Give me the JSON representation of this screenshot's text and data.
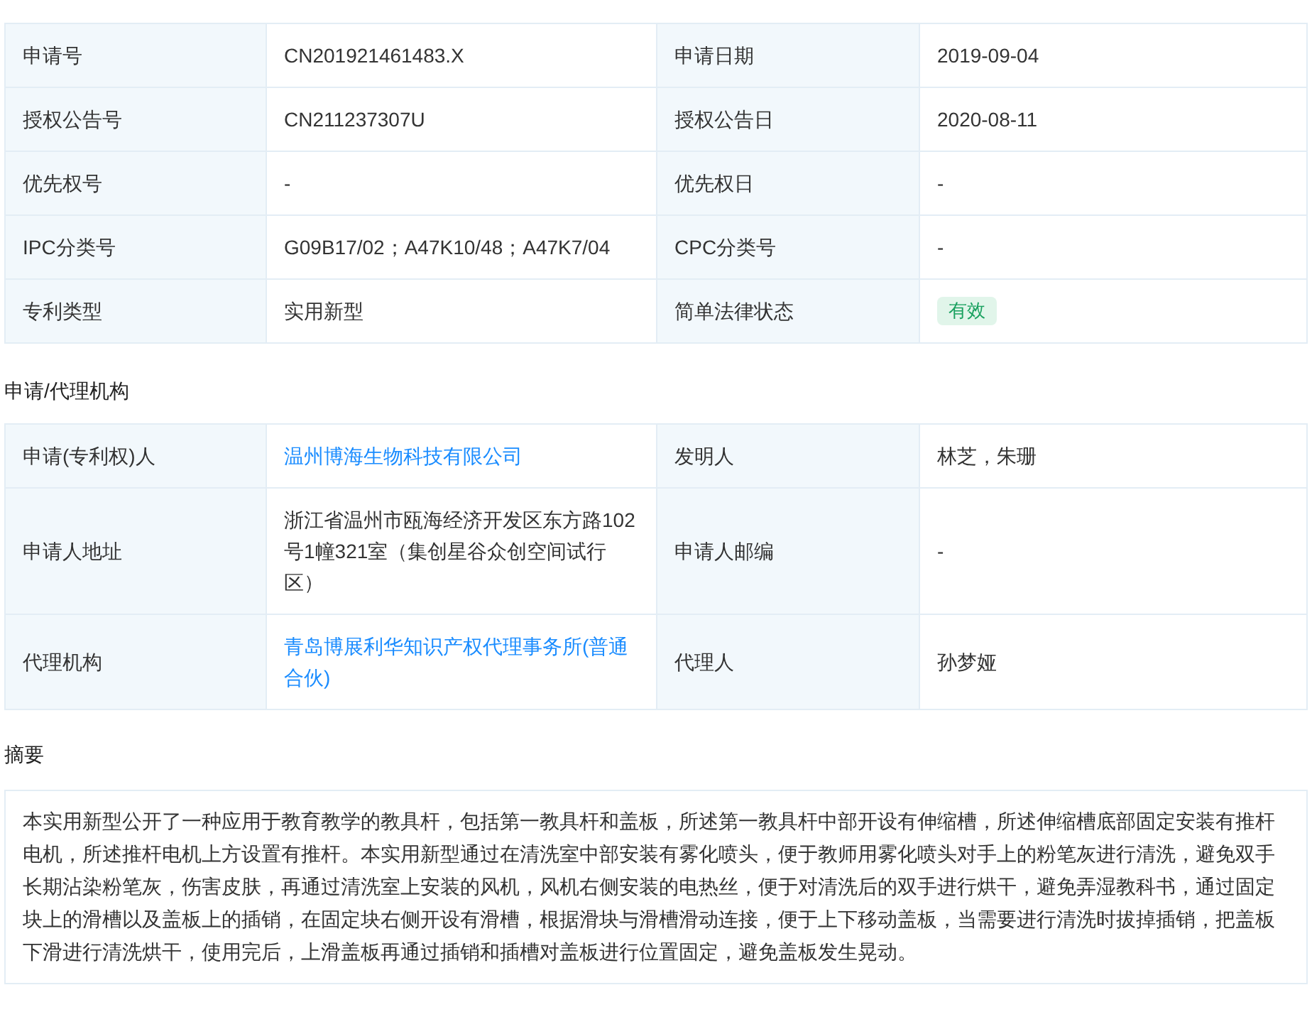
{
  "basic_info": {
    "rows": [
      {
        "cells": [
          {
            "label": "申请号",
            "value": "CN201921461483.X",
            "kind": "text"
          },
          {
            "label": "申请日期",
            "value": "2019-09-04",
            "kind": "text"
          }
        ]
      },
      {
        "cells": [
          {
            "label": "授权公告号",
            "value": "CN211237307U",
            "kind": "text"
          },
          {
            "label": "授权公告日",
            "value": "2020-08-11",
            "kind": "text"
          }
        ]
      },
      {
        "cells": [
          {
            "label": "优先权号",
            "value": "-",
            "kind": "text"
          },
          {
            "label": "优先权日",
            "value": "-",
            "kind": "text"
          }
        ]
      },
      {
        "cells": [
          {
            "label": "IPC分类号",
            "value": "G09B17/02；A47K10/48；A47K7/04",
            "kind": "text"
          },
          {
            "label": "CPC分类号",
            "value": "-",
            "kind": "text"
          }
        ]
      },
      {
        "cells": [
          {
            "label": "专利类型",
            "value": "实用新型",
            "kind": "text"
          },
          {
            "label": "简单法律状态",
            "value": "有效",
            "kind": "badge"
          }
        ]
      }
    ]
  },
  "applicant_agency": {
    "title": "申请/代理机构",
    "rows": [
      {
        "cells": [
          {
            "label": "申请(专利权)人",
            "value": "温州博海生物科技有限公司",
            "kind": "link"
          },
          {
            "label": "发明人",
            "value": "林芝，朱珊",
            "kind": "text"
          }
        ]
      },
      {
        "cells": [
          {
            "label": "申请人地址",
            "value": "浙江省温州市瓯海经济开发区东方路102号1幢321室（集创星谷众创空间试行区）",
            "kind": "text"
          },
          {
            "label": "申请人邮编",
            "value": "-",
            "kind": "text"
          }
        ]
      },
      {
        "cells": [
          {
            "label": "代理机构",
            "value": "青岛博展利华知识产权代理事务所(普通合伙)",
            "kind": "link"
          },
          {
            "label": "代理人",
            "value": "孙梦娅",
            "kind": "text"
          }
        ]
      }
    ]
  },
  "abstract": {
    "title": "摘要",
    "text": "本实用新型公开了一种应用于教育教学的教具杆，包括第一教具杆和盖板，所述第一教具杆中部开设有伸缩槽，所述伸缩槽底部固定安装有推杆电机，所述推杆电机上方设置有推杆。本实用新型通过在清洗室中部安装有雾化喷头，便于教师用雾化喷头对手上的粉笔灰进行清洗，避免双手长期沾染粉笔灰，伤害皮肤，再通过清洗室上安装的风机，风机右侧安装的电热丝，便于对清洗后的双手进行烘干，避免弄湿教科书，通过固定块上的滑槽以及盖板上的插销，在固定块右侧开设有滑槽，根据滑块与滑槽滑动连接，便于上下移动盖板，当需要进行清洗时拔掉插销，把盖板下滑进行清洗烘干，使用完后，上滑盖板再通过插销和插槽对盖板进行位置固定，避免盖板发生晃动。"
  }
}
